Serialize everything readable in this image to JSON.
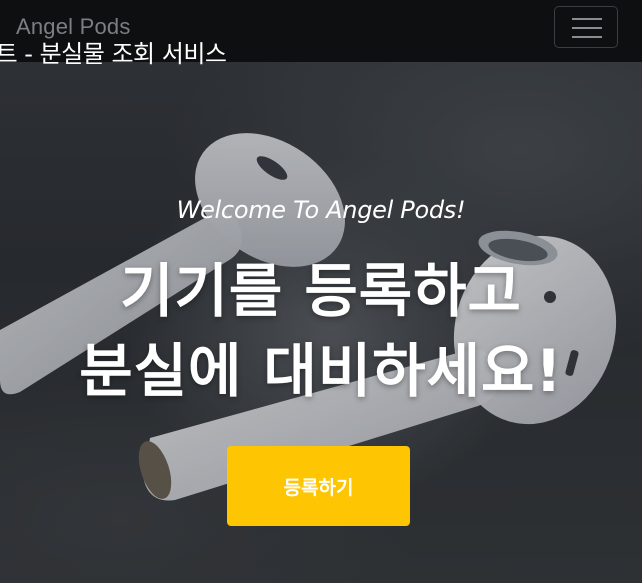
{
  "navbar": {
    "brand": "Angel Pods",
    "page_caption": "젝트 - 분실물 조회 서비스",
    "menu_icon": "hamburger-menu-icon"
  },
  "hero": {
    "background_image": "white-earbuds-on-rock",
    "welcome": "Welcome To Angel Pods!",
    "headline_line1": "기기를 등록하고",
    "headline_line2": "분실에 대비하세요!",
    "cta_label": "등록하기"
  },
  "colors": {
    "navbar_bg": "#0e0f10",
    "cta_bg": "#fec503",
    "text": "#ffffff"
  }
}
